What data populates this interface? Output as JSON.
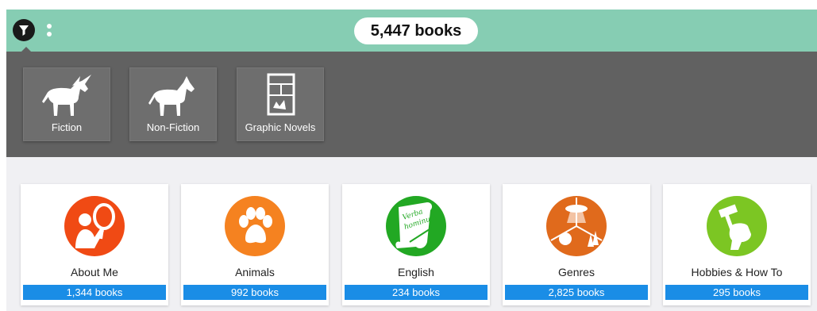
{
  "header": {
    "total_count": "5,447 books",
    "accent_color": "#86cdb3"
  },
  "categories": [
    {
      "label": "Fiction",
      "icon": "unicorn-icon"
    },
    {
      "label": "Non-Fiction",
      "icon": "horse-icon"
    },
    {
      "label": "Graphic Novels",
      "icon": "comic-panel-icon"
    }
  ],
  "collections": [
    {
      "title": "About Me",
      "count": "1,344 books",
      "icon": "mirror-person-icon",
      "color": "#f04a14"
    },
    {
      "title": "Animals",
      "count": "992 books",
      "icon": "paw-icon",
      "color": "#f58220"
    },
    {
      "title": "English",
      "count": "234 books",
      "icon": "scroll-quill-icon",
      "color": "#22a823",
      "scroll_text": [
        "Verba",
        "hominum"
      ]
    },
    {
      "title": "Genres",
      "count": "2,825 books",
      "icon": "genres-collage-icon",
      "color": "#e06a1c"
    },
    {
      "title": "Hobbies & How To",
      "count": "295 books",
      "icon": "hammer-fist-icon",
      "color": "#7cc623"
    }
  ],
  "count_bar_color": "#1a8de6"
}
